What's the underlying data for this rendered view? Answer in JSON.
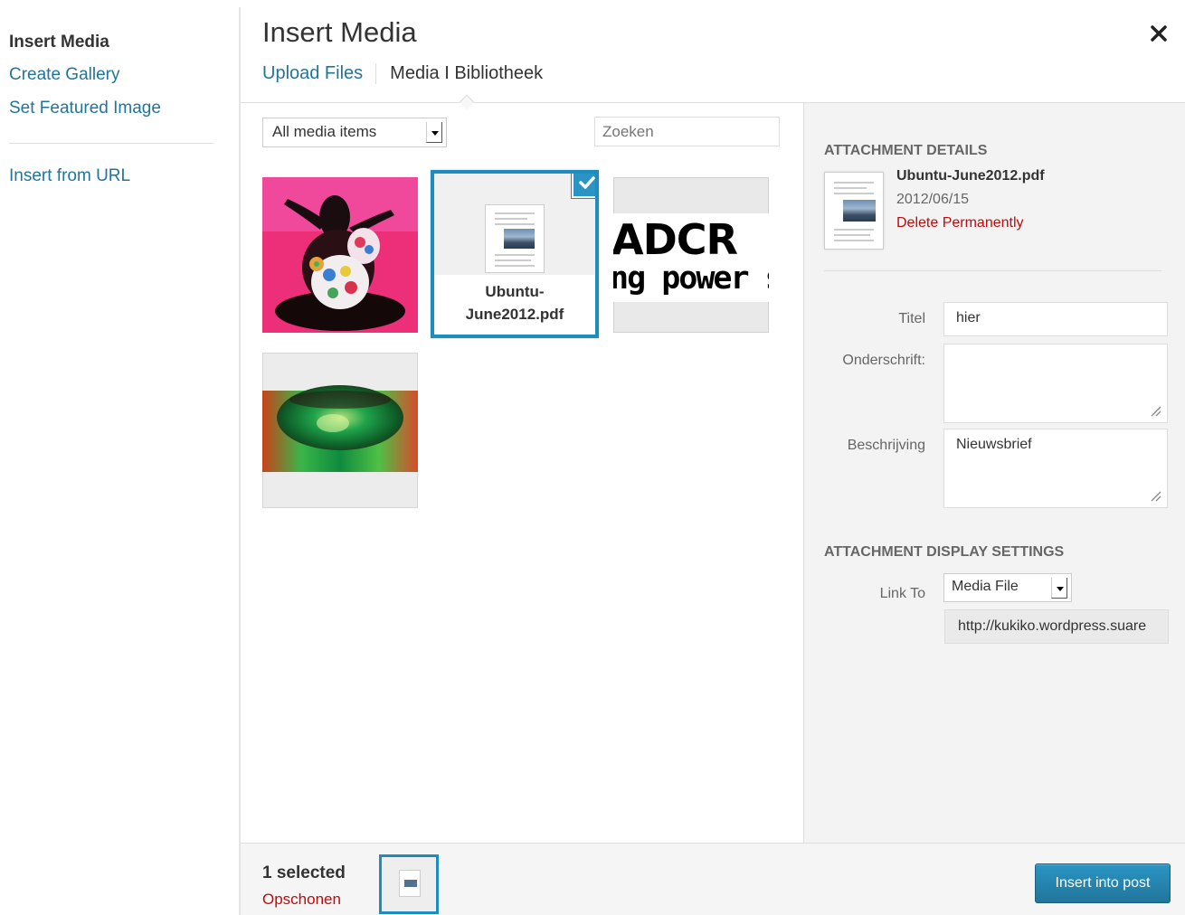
{
  "menu": {
    "insert_media": "Insert Media",
    "create_gallery": "Create Gallery",
    "set_featured_image": "Set Featured Image",
    "insert_from_url": "Insert from URL"
  },
  "frame": {
    "title": "Insert Media",
    "close_icon": "close-icon",
    "tabs": {
      "upload": "Upload Files",
      "library": "Media I Bibliotheek"
    }
  },
  "toolbar_filters": {
    "filter_selected": "All media items",
    "search_placeholder": "Zoeken"
  },
  "attachments": [
    {
      "type": "image",
      "desc": "colorful figurine"
    },
    {
      "type": "document",
      "filename": "Ubuntu-June2012.pdf",
      "filename_line1": "Ubuntu-",
      "filename_line2": "June2012.pdf",
      "selected": true
    },
    {
      "type": "image",
      "logo_line1": "ADCR",
      "logo_line2": "ng power sol"
    },
    {
      "type": "image",
      "desc": "green glass"
    }
  ],
  "details": {
    "heading": "ATTACHMENT DETAILS",
    "filename": "Ubuntu-June2012.pdf",
    "date": "2012/06/15",
    "delete_label": "Delete Permanently",
    "fields": {
      "title_label": "Titel",
      "title_value": "hier",
      "caption_label": "Onderschrift:",
      "caption_value": "",
      "description_label": "Beschrijving",
      "description_value": "Nieuwsbrief"
    }
  },
  "display_settings": {
    "heading": "ATTACHMENT DISPLAY SETTINGS",
    "link_to_label": "Link To",
    "link_to_value": "Media File",
    "url": "http://kukiko.wordpress.suare"
  },
  "bottom_toolbar": {
    "selected_count": "1 selected",
    "clear_label": "Opschonen",
    "insert_button": "Insert into post"
  },
  "colors": {
    "accent": "#21759b",
    "selection": "#1e8cbe",
    "danger": "#bc0b0b"
  }
}
